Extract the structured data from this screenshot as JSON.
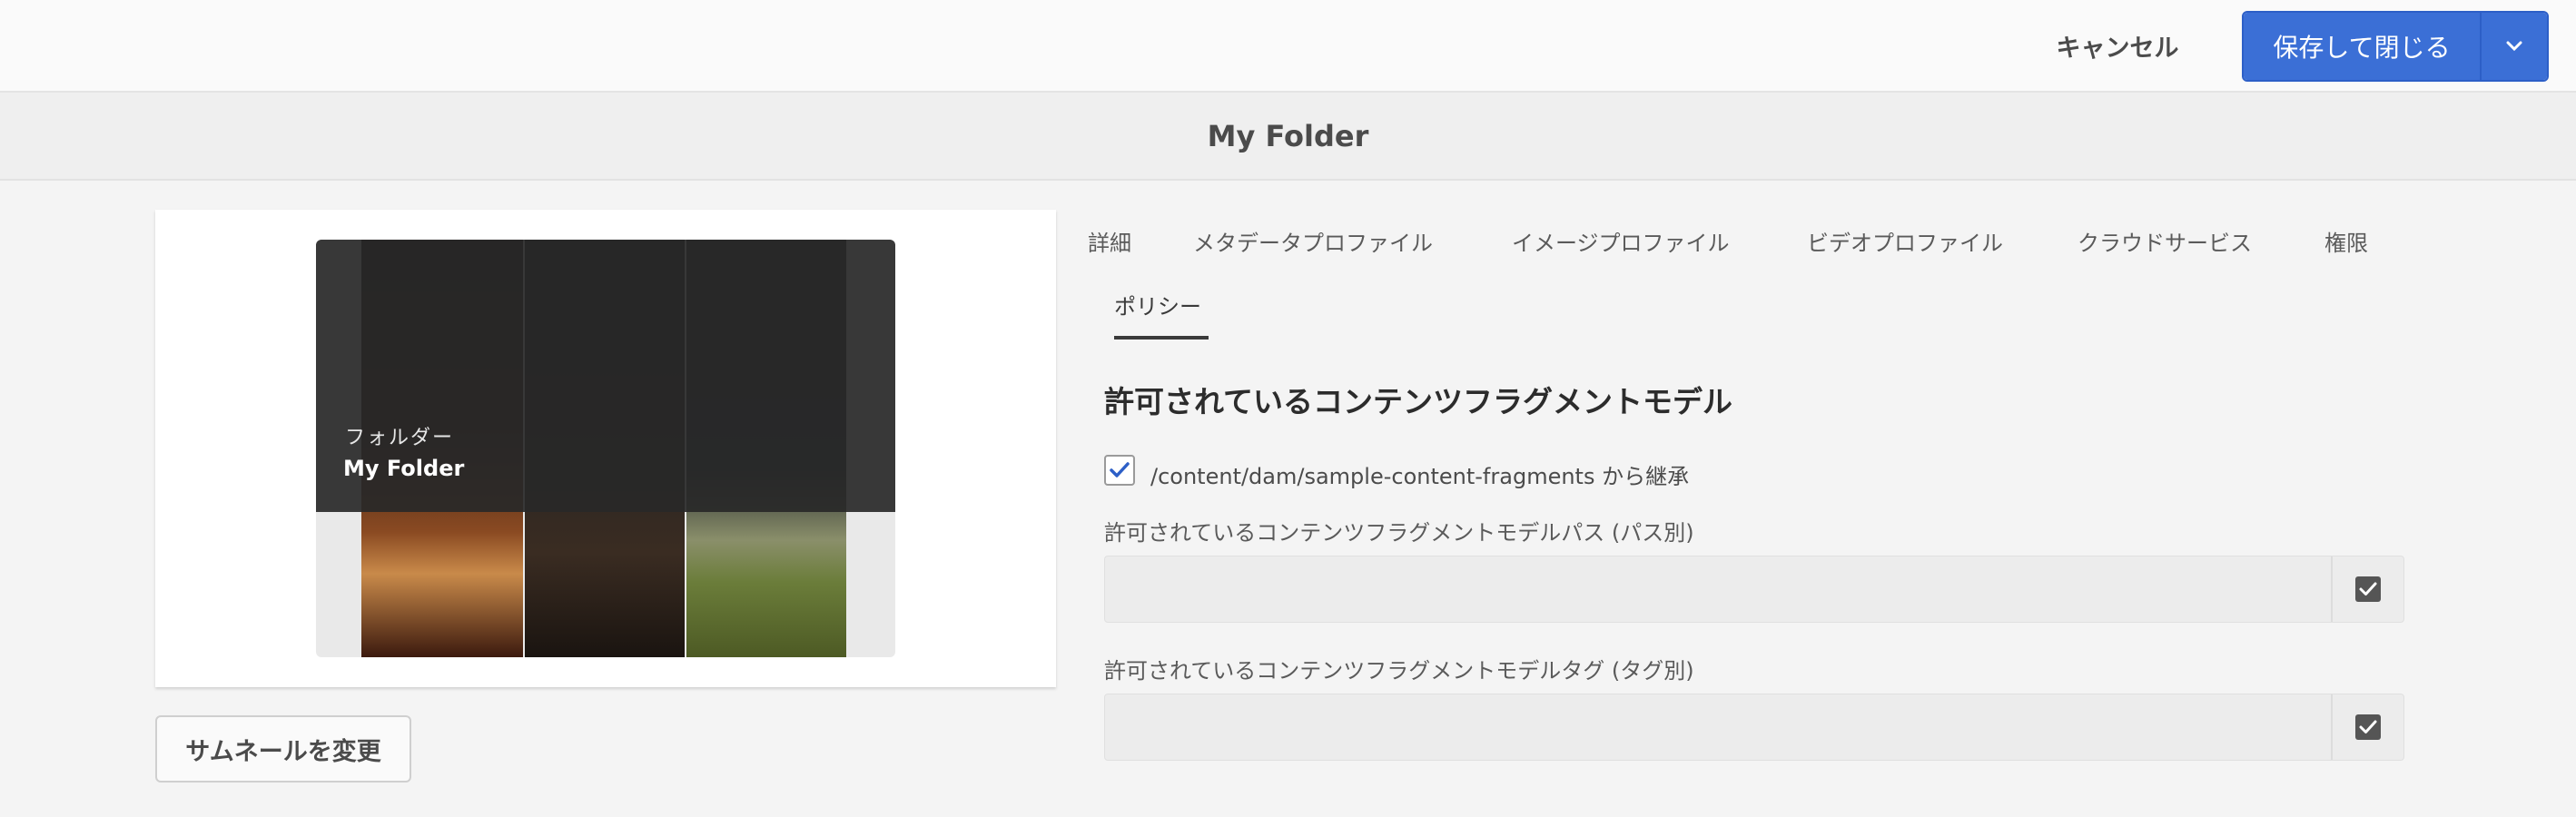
{
  "actions": {
    "cancel_label": "キャンセル",
    "save_label": "保存して閉じる"
  },
  "header": {
    "title": "My Folder"
  },
  "thumbnail": {
    "type_label": "フォルダー",
    "name": "My Folder",
    "change_label": "サムネールを変更"
  },
  "tabs": [
    {
      "label": "詳細"
    },
    {
      "label": "メタデータプロファイル"
    },
    {
      "label": "イメージプロファイル"
    },
    {
      "label": "ビデオプロファイル"
    },
    {
      "label": "クラウドサービス"
    },
    {
      "label": "権限"
    },
    {
      "label": "ポリシー",
      "active": true
    }
  ],
  "policy": {
    "section_title": "許可されているコンテンツフラグメントモデル",
    "inherit_label": "/content/dam/sample-content-fragments から継承",
    "inherit_checked": true,
    "path_label": "許可されているコンテンツフラグメントモデルパス (パス別)",
    "path_value": "",
    "tag_label": "許可されているコンテンツフラグメントモデルタグ (タグ別)",
    "tag_value": ""
  },
  "colors": {
    "accent": "#3b6fd6",
    "checkbox": "#2d5fc7"
  }
}
